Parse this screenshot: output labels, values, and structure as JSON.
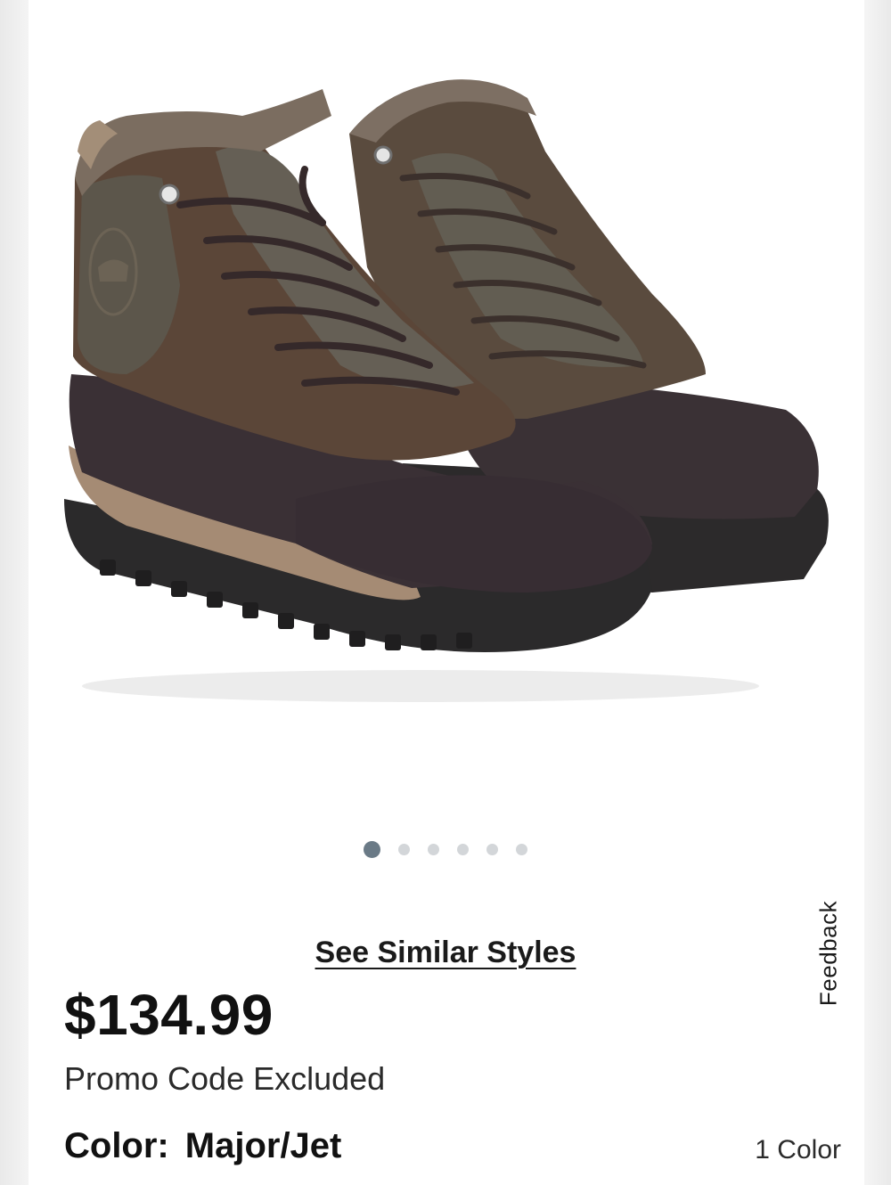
{
  "product": {
    "image_alt": "",
    "gallery": {
      "total": 6,
      "active_index": 0
    }
  },
  "links": {
    "see_similar": "See Similar Styles"
  },
  "feedback": {
    "label": "Feedback"
  },
  "pricing": {
    "price": "$134.99",
    "promo_note": "Promo Code Excluded"
  },
  "color": {
    "label": "Color:",
    "value": "Major/Jet",
    "count": "1 Color"
  },
  "colors": {
    "active_dot": "#6a7a86",
    "inactive_dot": "#d3d6d9"
  }
}
